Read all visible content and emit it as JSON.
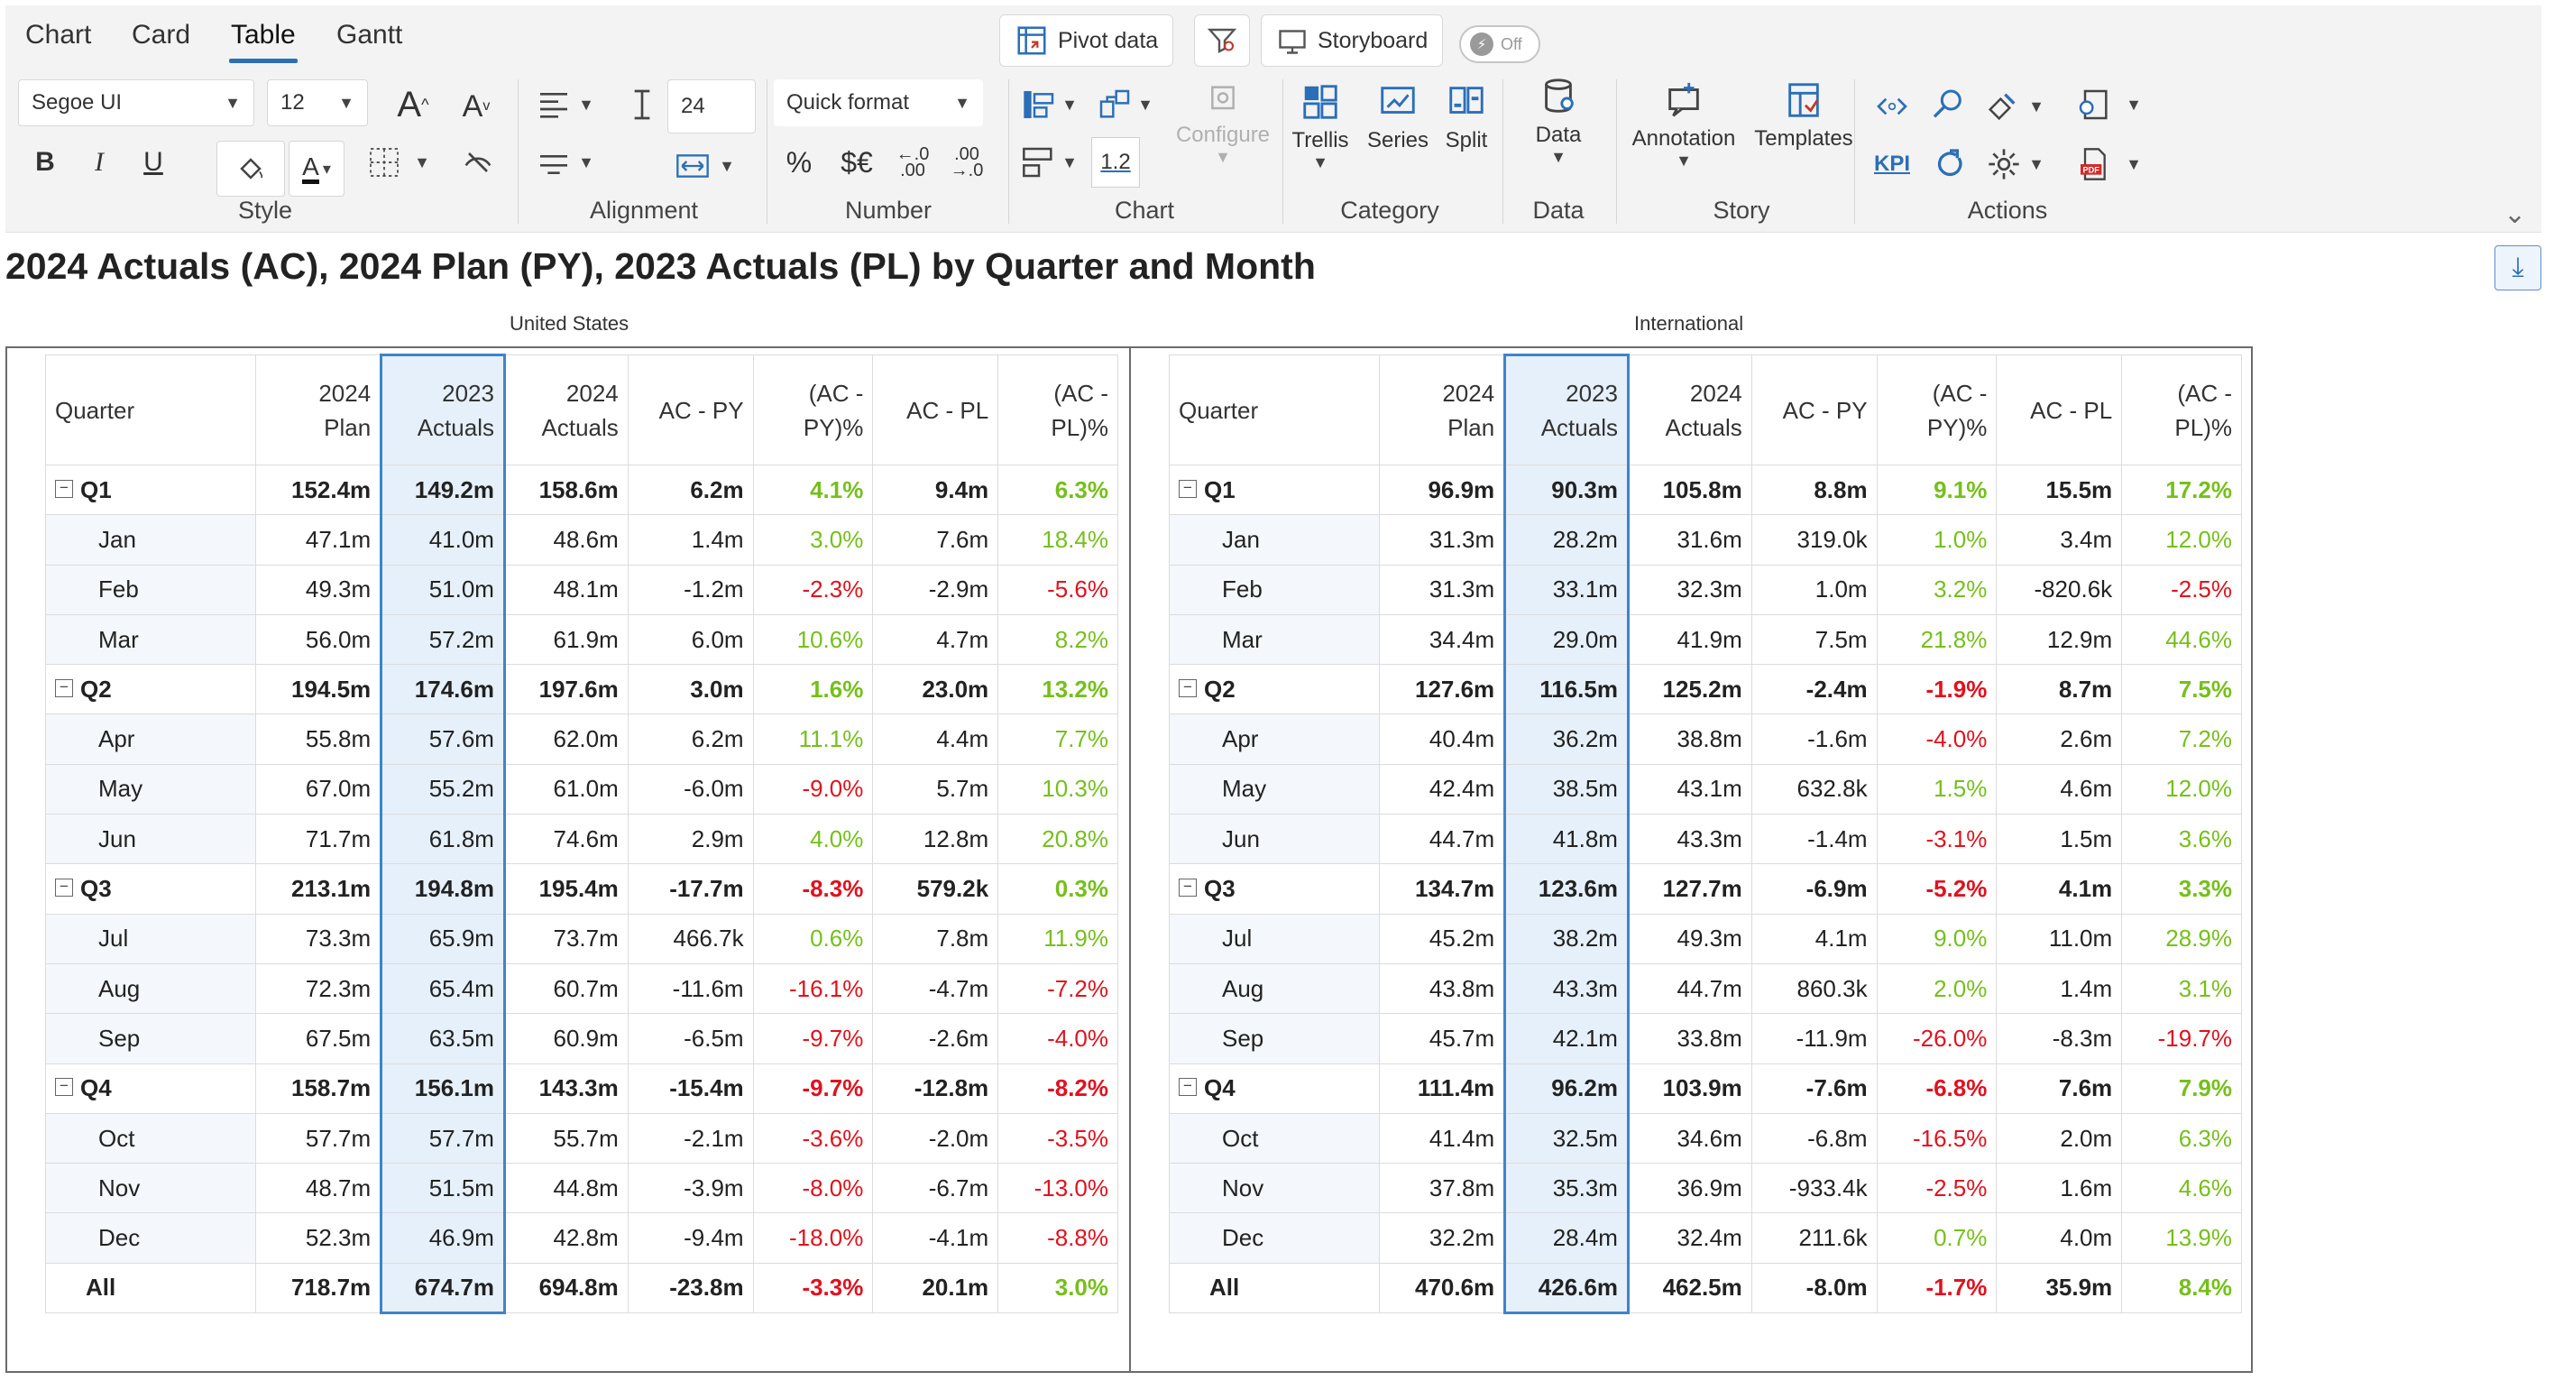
{
  "tabs": [
    "Chart",
    "Card",
    "Table",
    "Gantt"
  ],
  "active_tab": "Table",
  "topbar": {
    "pivot": "Pivot data",
    "storyboard": "Storyboard",
    "toggle": "Off"
  },
  "style": {
    "font": "Segoe UI",
    "size": "12",
    "label": "Style"
  },
  "alignment": {
    "label": "Alignment",
    "height_value": "24"
  },
  "number": {
    "label": "Number",
    "quick_format": "Quick format"
  },
  "chart_group": {
    "label": "Chart",
    "configure": "Configure",
    "decimal": "1.2"
  },
  "category": {
    "label": "Category",
    "trellis": "Trellis",
    "series": "Series",
    "split": "Split"
  },
  "data_group": {
    "label": "Data",
    "data": "Data"
  },
  "story": {
    "label": "Story",
    "annotation": "Annotation",
    "templates": "Templates"
  },
  "actions": {
    "label": "Actions",
    "kpi": "KPI"
  },
  "title": "2024 Actuals (AC), 2024 Plan (PY), 2023 Actuals (PL) by Quarter and Month",
  "headers": [
    "Quarter",
    "2024 Plan",
    "2023\nActuals",
    "2024\nActuals",
    "AC - PY",
    "(AC -\nPY)%",
    "AC - PL",
    "(AC -\nPL)%"
  ],
  "panes": [
    {
      "name": "United States",
      "rows": [
        {
          "type": "q",
          "label": "Q1",
          "v": [
            "152.4m",
            "149.2m",
            "158.6m",
            "6.2m",
            "4.1%",
            "9.4m",
            "6.3%"
          ]
        },
        {
          "type": "m",
          "label": "Jan",
          "v": [
            "47.1m",
            "41.0m",
            "48.6m",
            "1.4m",
            "3.0%",
            "7.6m",
            "18.4%"
          ]
        },
        {
          "type": "m",
          "label": "Feb",
          "v": [
            "49.3m",
            "51.0m",
            "48.1m",
            "-1.2m",
            "-2.3%",
            "-2.9m",
            "-5.6%"
          ]
        },
        {
          "type": "m",
          "label": "Mar",
          "v": [
            "56.0m",
            "57.2m",
            "61.9m",
            "6.0m",
            "10.6%",
            "4.7m",
            "8.2%"
          ]
        },
        {
          "type": "q",
          "label": "Q2",
          "v": [
            "194.5m",
            "174.6m",
            "197.6m",
            "3.0m",
            "1.6%",
            "23.0m",
            "13.2%"
          ]
        },
        {
          "type": "m",
          "label": "Apr",
          "v": [
            "55.8m",
            "57.6m",
            "62.0m",
            "6.2m",
            "11.1%",
            "4.4m",
            "7.7%"
          ]
        },
        {
          "type": "m",
          "label": "May",
          "v": [
            "67.0m",
            "55.2m",
            "61.0m",
            "-6.0m",
            "-9.0%",
            "5.7m",
            "10.3%"
          ]
        },
        {
          "type": "m",
          "label": "Jun",
          "v": [
            "71.7m",
            "61.8m",
            "74.6m",
            "2.9m",
            "4.0%",
            "12.8m",
            "20.8%"
          ]
        },
        {
          "type": "q",
          "label": "Q3",
          "v": [
            "213.1m",
            "194.8m",
            "195.4m",
            "-17.7m",
            "-8.3%",
            "579.2k",
            "0.3%"
          ]
        },
        {
          "type": "m",
          "label": "Jul",
          "v": [
            "73.3m",
            "65.9m",
            "73.7m",
            "466.7k",
            "0.6%",
            "7.8m",
            "11.9%"
          ]
        },
        {
          "type": "m",
          "label": "Aug",
          "v": [
            "72.3m",
            "65.4m",
            "60.7m",
            "-11.6m",
            "-16.1%",
            "-4.7m",
            "-7.2%"
          ]
        },
        {
          "type": "m",
          "label": "Sep",
          "v": [
            "67.5m",
            "63.5m",
            "60.9m",
            "-6.5m",
            "-9.7%",
            "-2.6m",
            "-4.0%"
          ]
        },
        {
          "type": "q",
          "label": "Q4",
          "v": [
            "158.7m",
            "156.1m",
            "143.3m",
            "-15.4m",
            "-9.7%",
            "-12.8m",
            "-8.2%"
          ]
        },
        {
          "type": "m",
          "label": "Oct",
          "v": [
            "57.7m",
            "57.7m",
            "55.7m",
            "-2.1m",
            "-3.6%",
            "-2.0m",
            "-3.5%"
          ]
        },
        {
          "type": "m",
          "label": "Nov",
          "v": [
            "48.7m",
            "51.5m",
            "44.8m",
            "-3.9m",
            "-8.0%",
            "-6.7m",
            "-13.0%"
          ]
        },
        {
          "type": "m",
          "label": "Dec",
          "v": [
            "52.3m",
            "46.9m",
            "42.8m",
            "-9.4m",
            "-18.0%",
            "-4.1m",
            "-8.8%"
          ]
        },
        {
          "type": "all",
          "label": "All",
          "v": [
            "718.7m",
            "674.7m",
            "694.8m",
            "-23.8m",
            "-3.3%",
            "20.1m",
            "3.0%"
          ]
        }
      ]
    },
    {
      "name": "International",
      "rows": [
        {
          "type": "q",
          "label": "Q1",
          "v": [
            "96.9m",
            "90.3m",
            "105.8m",
            "8.8m",
            "9.1%",
            "15.5m",
            "17.2%"
          ]
        },
        {
          "type": "m",
          "label": "Jan",
          "v": [
            "31.3m",
            "28.2m",
            "31.6m",
            "319.0k",
            "1.0%",
            "3.4m",
            "12.0%"
          ]
        },
        {
          "type": "m",
          "label": "Feb",
          "v": [
            "31.3m",
            "33.1m",
            "32.3m",
            "1.0m",
            "3.2%",
            "-820.6k",
            "-2.5%"
          ]
        },
        {
          "type": "m",
          "label": "Mar",
          "v": [
            "34.4m",
            "29.0m",
            "41.9m",
            "7.5m",
            "21.8%",
            "12.9m",
            "44.6%"
          ]
        },
        {
          "type": "q",
          "label": "Q2",
          "v": [
            "127.6m",
            "116.5m",
            "125.2m",
            "-2.4m",
            "-1.9%",
            "8.7m",
            "7.5%"
          ]
        },
        {
          "type": "m",
          "label": "Apr",
          "v": [
            "40.4m",
            "36.2m",
            "38.8m",
            "-1.6m",
            "-4.0%",
            "2.6m",
            "7.2%"
          ]
        },
        {
          "type": "m",
          "label": "May",
          "v": [
            "42.4m",
            "38.5m",
            "43.1m",
            "632.8k",
            "1.5%",
            "4.6m",
            "12.0%"
          ]
        },
        {
          "type": "m",
          "label": "Jun",
          "v": [
            "44.7m",
            "41.8m",
            "43.3m",
            "-1.4m",
            "-3.1%",
            "1.5m",
            "3.6%"
          ]
        },
        {
          "type": "q",
          "label": "Q3",
          "v": [
            "134.7m",
            "123.6m",
            "127.7m",
            "-6.9m",
            "-5.2%",
            "4.1m",
            "3.3%"
          ]
        },
        {
          "type": "m",
          "label": "Jul",
          "v": [
            "45.2m",
            "38.2m",
            "49.3m",
            "4.1m",
            "9.0%",
            "11.0m",
            "28.9%"
          ]
        },
        {
          "type": "m",
          "label": "Aug",
          "v": [
            "43.8m",
            "43.3m",
            "44.7m",
            "860.3k",
            "2.0%",
            "1.4m",
            "3.1%"
          ]
        },
        {
          "type": "m",
          "label": "Sep",
          "v": [
            "45.7m",
            "42.1m",
            "33.8m",
            "-11.9m",
            "-26.0%",
            "-8.3m",
            "-19.7%"
          ]
        },
        {
          "type": "q",
          "label": "Q4",
          "v": [
            "111.4m",
            "96.2m",
            "103.9m",
            "-7.6m",
            "-6.8%",
            "7.6m",
            "7.9%"
          ]
        },
        {
          "type": "m",
          "label": "Oct",
          "v": [
            "41.4m",
            "32.5m",
            "34.6m",
            "-6.8m",
            "-16.5%",
            "2.0m",
            "6.3%"
          ]
        },
        {
          "type": "m",
          "label": "Nov",
          "v": [
            "37.8m",
            "35.3m",
            "36.9m",
            "-933.4k",
            "-2.5%",
            "1.6m",
            "4.6%"
          ]
        },
        {
          "type": "m",
          "label": "Dec",
          "v": [
            "32.2m",
            "28.4m",
            "32.4m",
            "211.6k",
            "0.7%",
            "4.0m",
            "13.9%"
          ]
        },
        {
          "type": "all",
          "label": "All",
          "v": [
            "470.6m",
            "426.6m",
            "462.5m",
            "-8.0m",
            "-1.7%",
            "35.9m",
            "8.4%"
          ]
        }
      ]
    }
  ],
  "colors": {
    "positive": "#76bf1b",
    "negative": "#e0121f",
    "highlight_border": "#3f84c9",
    "highlight_fill": "#e6f0fa"
  }
}
